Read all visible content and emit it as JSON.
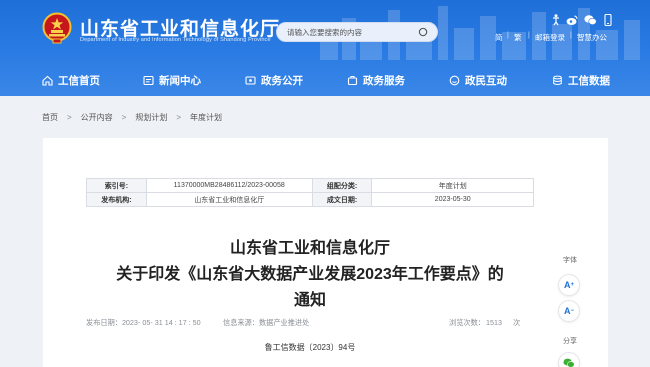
{
  "header": {
    "site_title": "山东省工业和信息化厅",
    "site_subtitle": "Department of Industry and Information Technology of Shandong Province",
    "search_placeholder": "请输入您要搜索的内容",
    "links": [
      "简",
      "繁",
      "邮箱登录",
      "智慧办公"
    ]
  },
  "nav": {
    "items": [
      "工信首页",
      "新闻中心",
      "政务公开",
      "政务服务",
      "政民互动",
      "工信数据"
    ]
  },
  "breadcrumb": [
    "首页",
    "公开内容",
    "规划计划",
    "年度计划"
  ],
  "meta_table": {
    "index_label": "索引号:",
    "index_value": "11370000MB28486112/2023-00058",
    "category_label": "组配分类:",
    "category_value": "年度计划",
    "publisher_label": "发布机构:",
    "publisher_value": "山东省工业和信息化厅",
    "date_label": "成文日期:",
    "date_value": "2023-05-30"
  },
  "article": {
    "title_line1": "山东省工业和信息化厅",
    "title_line2": "关于印发《山东省大数据产业发展2023年工作要点》的",
    "title_line3": "通知",
    "publish_time": "发布日期：2023- 05- 31 14 : 17 : 50",
    "source": "信息来源：数据产业推进处",
    "views_label": "浏览次数：",
    "views": "1513",
    "views_unit": "次",
    "doc_number": "鲁工信数据〔2023〕94号"
  },
  "side_tools": {
    "font_label": "字体",
    "increase": "A",
    "decrease": "A",
    "share_label": "分享"
  },
  "colors": {
    "brand_blue": "#2a7be3",
    "accent_red": "#c8161d"
  }
}
